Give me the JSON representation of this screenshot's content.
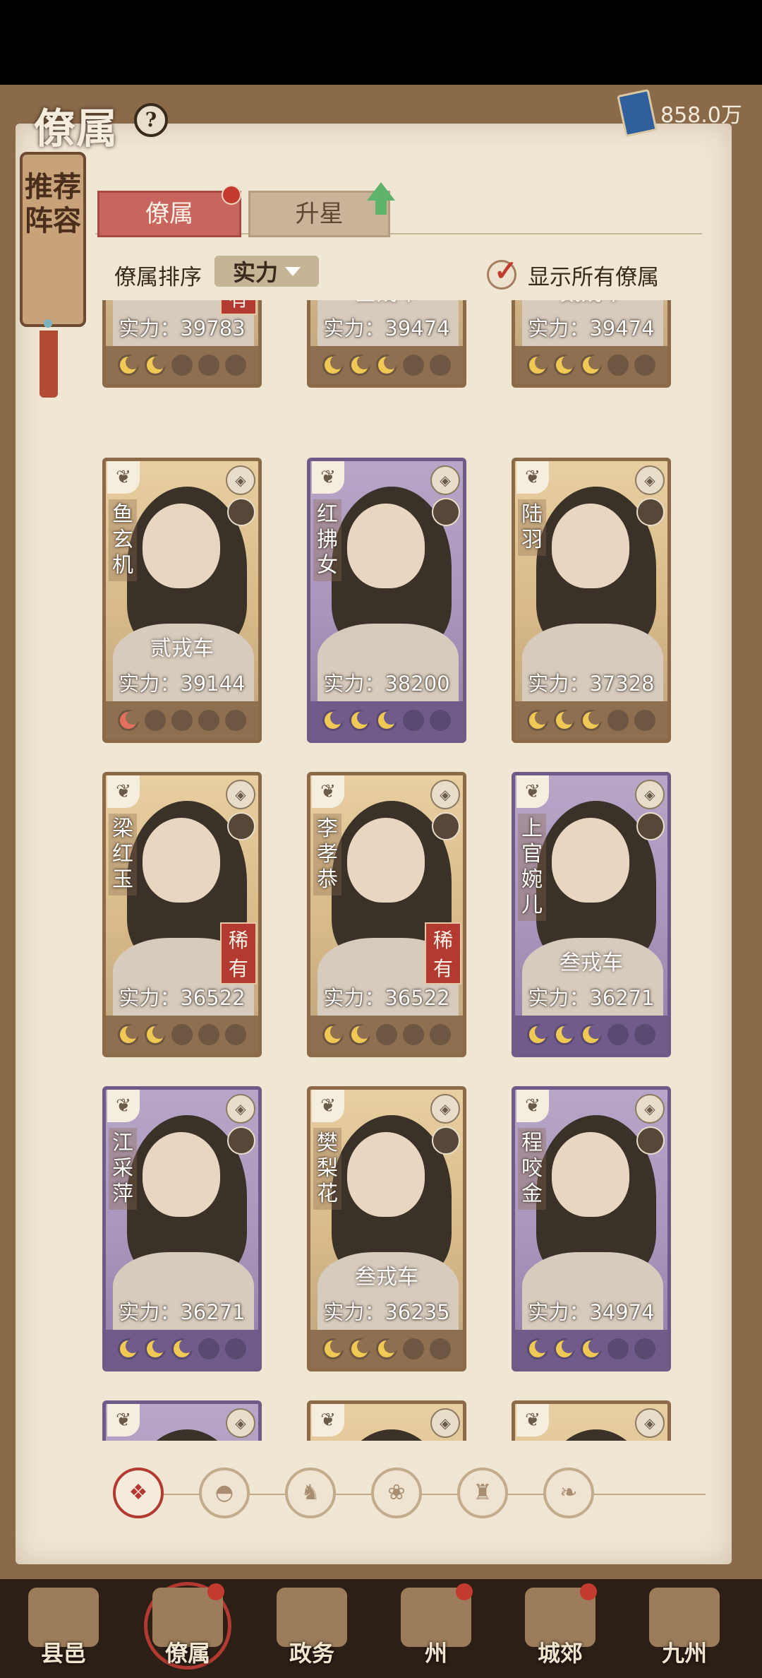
{
  "header": {
    "title": "僚属",
    "help_icon": "question-icon",
    "currency_value": "858.0万"
  },
  "side_scroll": {
    "label": "推荐阵容"
  },
  "tabs": [
    {
      "label": "僚属",
      "active": true,
      "has_dot": true
    },
    {
      "label": "升星",
      "active": false,
      "has_arrow": true
    }
  ],
  "sort": {
    "label": "僚属排序",
    "value": "实力"
  },
  "show_all": {
    "label": "显示所有僚属",
    "checked": true
  },
  "cards": [
    {
      "name": "",
      "rank": "",
      "rare": "稀有",
      "power": "实力：39783",
      "frame": "gold",
      "stars": 2
    },
    {
      "name": "",
      "rank": "叁戎车",
      "rare": "",
      "power": "实力：39474",
      "frame": "gold",
      "stars": 3
    },
    {
      "name": "",
      "rank": "贰戎车",
      "rare": "",
      "power": "实力：39474",
      "frame": "gold",
      "stars": 3
    },
    {
      "name": "鱼玄机",
      "rank": "贰戎车",
      "rare": "",
      "power": "实力：39144",
      "frame": "gold",
      "stars": 1,
      "red": true
    },
    {
      "name": "红拂女",
      "rank": "",
      "rare": "",
      "power": "实力：38200",
      "frame": "purple",
      "stars": 3
    },
    {
      "name": "陆羽",
      "rank": "",
      "rare": "",
      "power": "实力：37328",
      "frame": "gold",
      "stars": 3
    },
    {
      "name": "梁红玉",
      "rank": "",
      "rare": "稀有",
      "power": "实力：36522",
      "frame": "gold",
      "stars": 2
    },
    {
      "name": "李孝恭",
      "rank": "",
      "rare": "稀有",
      "power": "实力：36522",
      "frame": "gold",
      "stars": 2
    },
    {
      "name": "上官婉儿",
      "rank": "叁戎车",
      "rare": "",
      "power": "实力：36271",
      "frame": "purple",
      "stars": 3
    },
    {
      "name": "江采萍",
      "rank": "",
      "rare": "",
      "power": "实力：36271",
      "frame": "purple",
      "stars": 3
    },
    {
      "name": "樊梨花",
      "rank": "叁戎车",
      "rare": "",
      "power": "实力：36235",
      "frame": "gold",
      "stars": 3
    },
    {
      "name": "程咬金",
      "rank": "",
      "rare": "",
      "power": "实力：34974",
      "frame": "purple",
      "stars": 3
    },
    {
      "name": "",
      "rank": "",
      "rare": "",
      "power": "",
      "frame": "purple",
      "stars": 0
    },
    {
      "name": "",
      "rank": "",
      "rare": "",
      "power": "",
      "frame": "gold",
      "stars": 0
    },
    {
      "name": "",
      "rank": "",
      "rare": "",
      "power": "",
      "frame": "gold",
      "stars": 0
    }
  ],
  "filters": [
    "all-icon",
    "helmet-icon",
    "cat-icon",
    "fan-icon",
    "beast-icon",
    "leaf-icon"
  ],
  "nav": [
    {
      "label": "县邑",
      "dot": false
    },
    {
      "label": "僚属",
      "dot": true,
      "active": true
    },
    {
      "label": "政务",
      "dot": false
    },
    {
      "label": "州",
      "dot": true
    },
    {
      "label": "城郊",
      "dot": true
    },
    {
      "label": "九州",
      "dot": false
    }
  ]
}
